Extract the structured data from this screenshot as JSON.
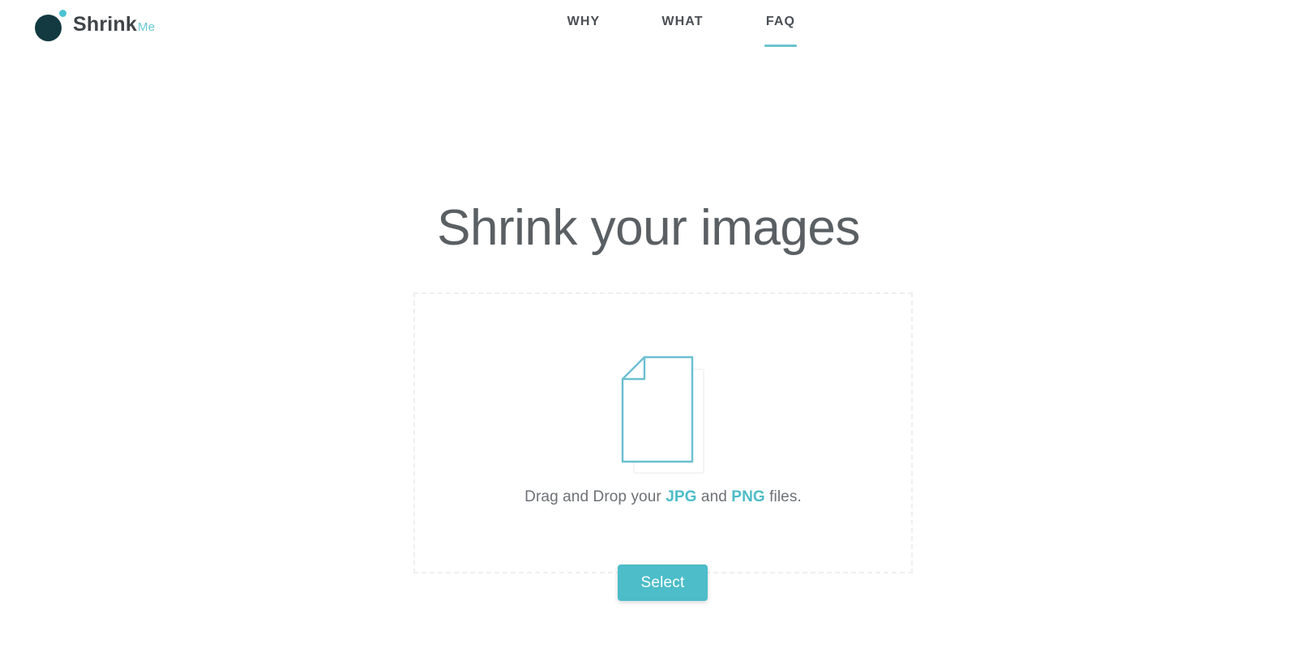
{
  "brand": {
    "name": "Shrink",
    "suffix": "Me",
    "circle_color": "#123a40",
    "dot_color": "#4cc3d0",
    "suffix_color": "#67c8d4"
  },
  "nav": {
    "items": [
      {
        "label": "WHY",
        "active": false
      },
      {
        "label": "WHAT",
        "active": false
      },
      {
        "label": "FAQ",
        "active": true
      }
    ],
    "active_underline_color": "#6bc5cf"
  },
  "hero": {
    "title": "Shrink your images"
  },
  "dropzone": {
    "icon_name": "document-page-icon",
    "icon_color": "#6bbfd0",
    "caption": {
      "prefix": "Drag and Drop your ",
      "format_one": "JPG",
      "middle": " and ",
      "format_two": "PNG",
      "suffix": " files."
    },
    "border_color": "#efefef"
  },
  "actions": {
    "select_label": "Select",
    "select_color": "#4cbdc9"
  }
}
